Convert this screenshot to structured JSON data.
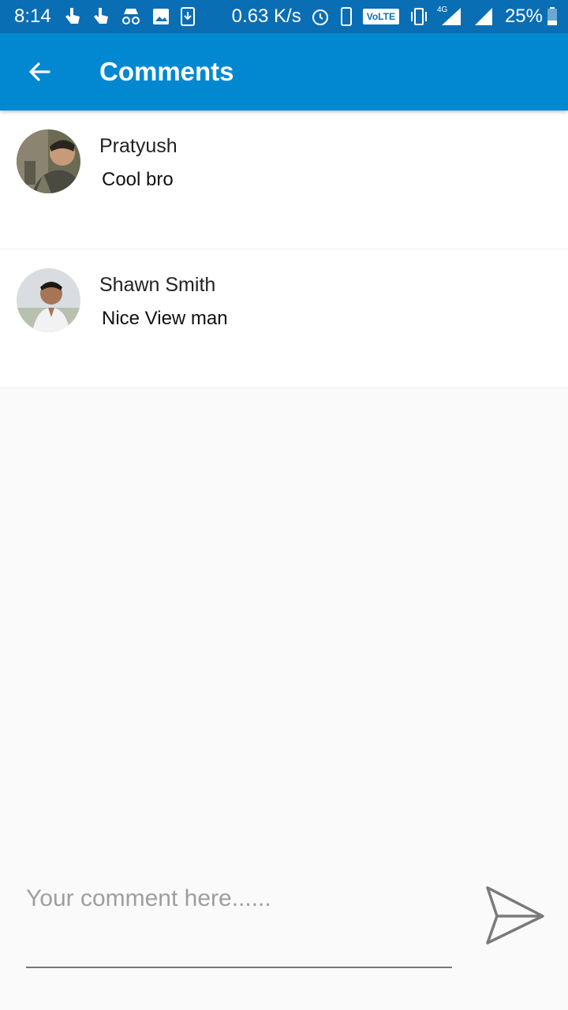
{
  "status_bar": {
    "time": "8:14",
    "network_speed": "0.63 K/s",
    "volte_label": "VoLTE",
    "network_type": "4G",
    "battery": "25%",
    "icons": [
      "touch-icon",
      "touch-icon",
      "incognito-icon",
      "image-icon",
      "download-icon",
      "alarm-icon",
      "phone-icon",
      "vibrate-icon",
      "signal-icon",
      "battery-icon"
    ]
  },
  "app_bar": {
    "title": "Comments",
    "back_icon": "arrow-back-icon",
    "color": "#0288d1"
  },
  "comments": [
    {
      "author": "Pratyush",
      "text": "Cool bro"
    },
    {
      "author": "Shawn Smith",
      "text": "Nice View man"
    }
  ],
  "composer": {
    "placeholder": "Your comment here......",
    "value": "",
    "send_icon": "send-icon"
  }
}
